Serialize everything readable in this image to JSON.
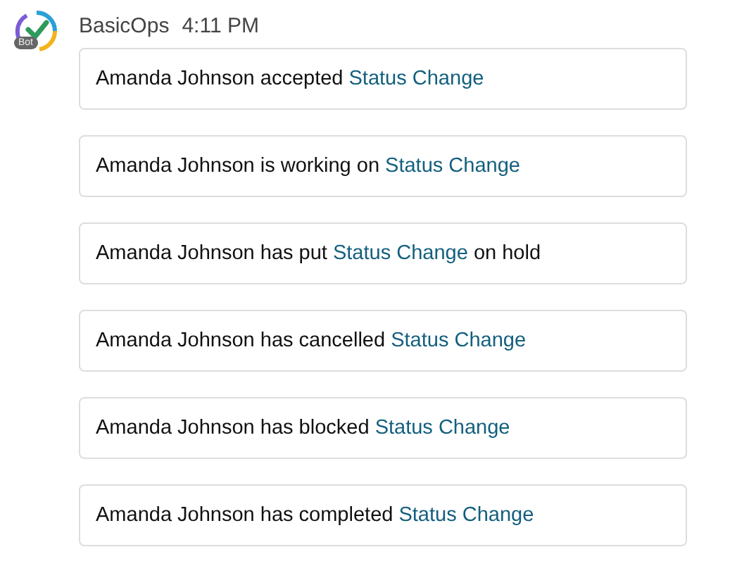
{
  "sender": {
    "name": "BasicOps",
    "time": "4:11 PM",
    "badge": "Bot"
  },
  "messages": [
    {
      "before": "Amanda Johnson accepted ",
      "link": "Status Change"
    },
    {
      "before": "Amanda Johnson is working on ",
      "link": "Status Change"
    },
    {
      "before": "Amanda Johnson has put ",
      "link": "Status Change",
      "after": " on hold"
    },
    {
      "before": "Amanda Johnson has cancelled ",
      "link": "Status Change"
    },
    {
      "before": "Amanda Johnson has blocked ",
      "link": "Status Change"
    },
    {
      "before": "Amanda Johnson has completed ",
      "link": "Status Change"
    }
  ]
}
